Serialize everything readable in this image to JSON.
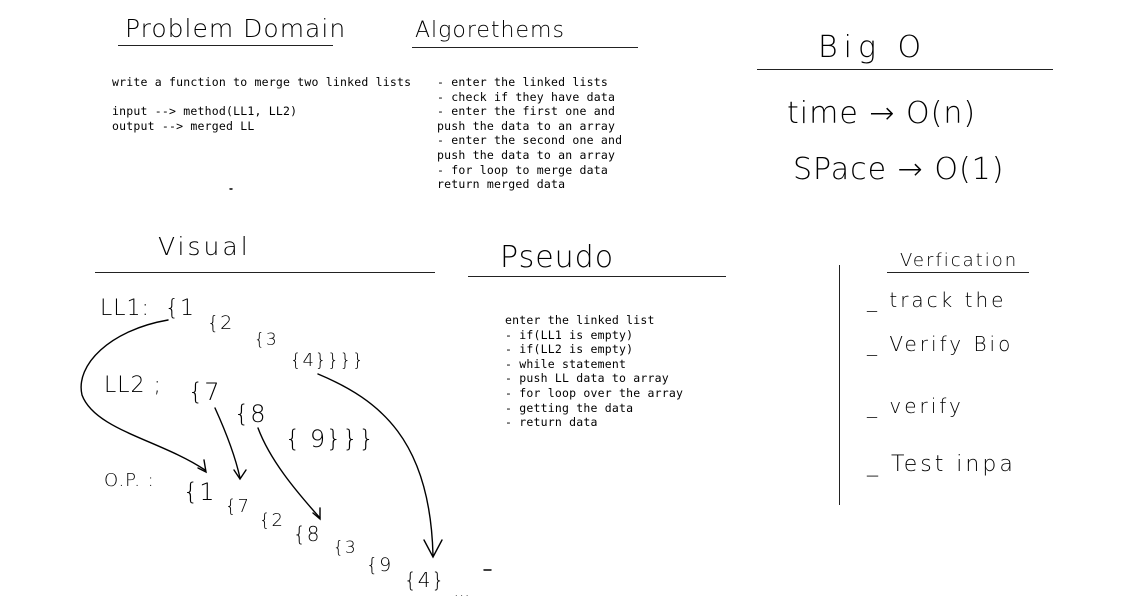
{
  "sections": {
    "problem_domain": {
      "title": "Problem Domain",
      "lines": [
        "write a function to merge two linked lists",
        "",
        "input --> method(LL1, LL2)",
        "output --> merged LL"
      ]
    },
    "algorithms": {
      "title": "Algorethems",
      "lines": [
        "- enter the linked lists",
        "- check if they have data",
        "- enter the first one and",
        "push the data to an array",
        "- enter the second one and",
        "push the data to an array",
        "- for loop to merge data",
        "return merged data"
      ]
    },
    "big_o": {
      "title": "Big O",
      "time_label": "time",
      "time_value": "O(n)",
      "space_label": "SPace",
      "space_value": "O(1)"
    },
    "visual": {
      "title": "Visual",
      "ll1_label": "LL1:",
      "ll1_nodes": [
        "{1",
        "{2",
        "{3",
        "{4}}}}"
      ],
      "ll2_label": "LL2 ;",
      "ll2_nodes": [
        "{7",
        "{8",
        "{ 9}}}"
      ],
      "op_label": "O.P. :",
      "op_nodes": [
        "{1",
        "{7",
        "{2",
        "{8",
        "{3",
        "{9",
        "{4}",
        "..."
      ]
    },
    "pseudo": {
      "title": "Pseudo",
      "lines": [
        "enter the linked list",
        "- if(LL1 is empty)",
        "- if(LL2 is empty)",
        "- while statement",
        "- push LL data to array",
        "- for loop over the array",
        "- getting the data",
        "- return data"
      ]
    },
    "verification": {
      "title": "Verfication",
      "items": [
        "_ track the",
        "_ Verify Bio",
        "_ verify",
        "_ Test inpa"
      ]
    }
  },
  "colors": {
    "ink": "#000000",
    "background": "#ffffff"
  }
}
